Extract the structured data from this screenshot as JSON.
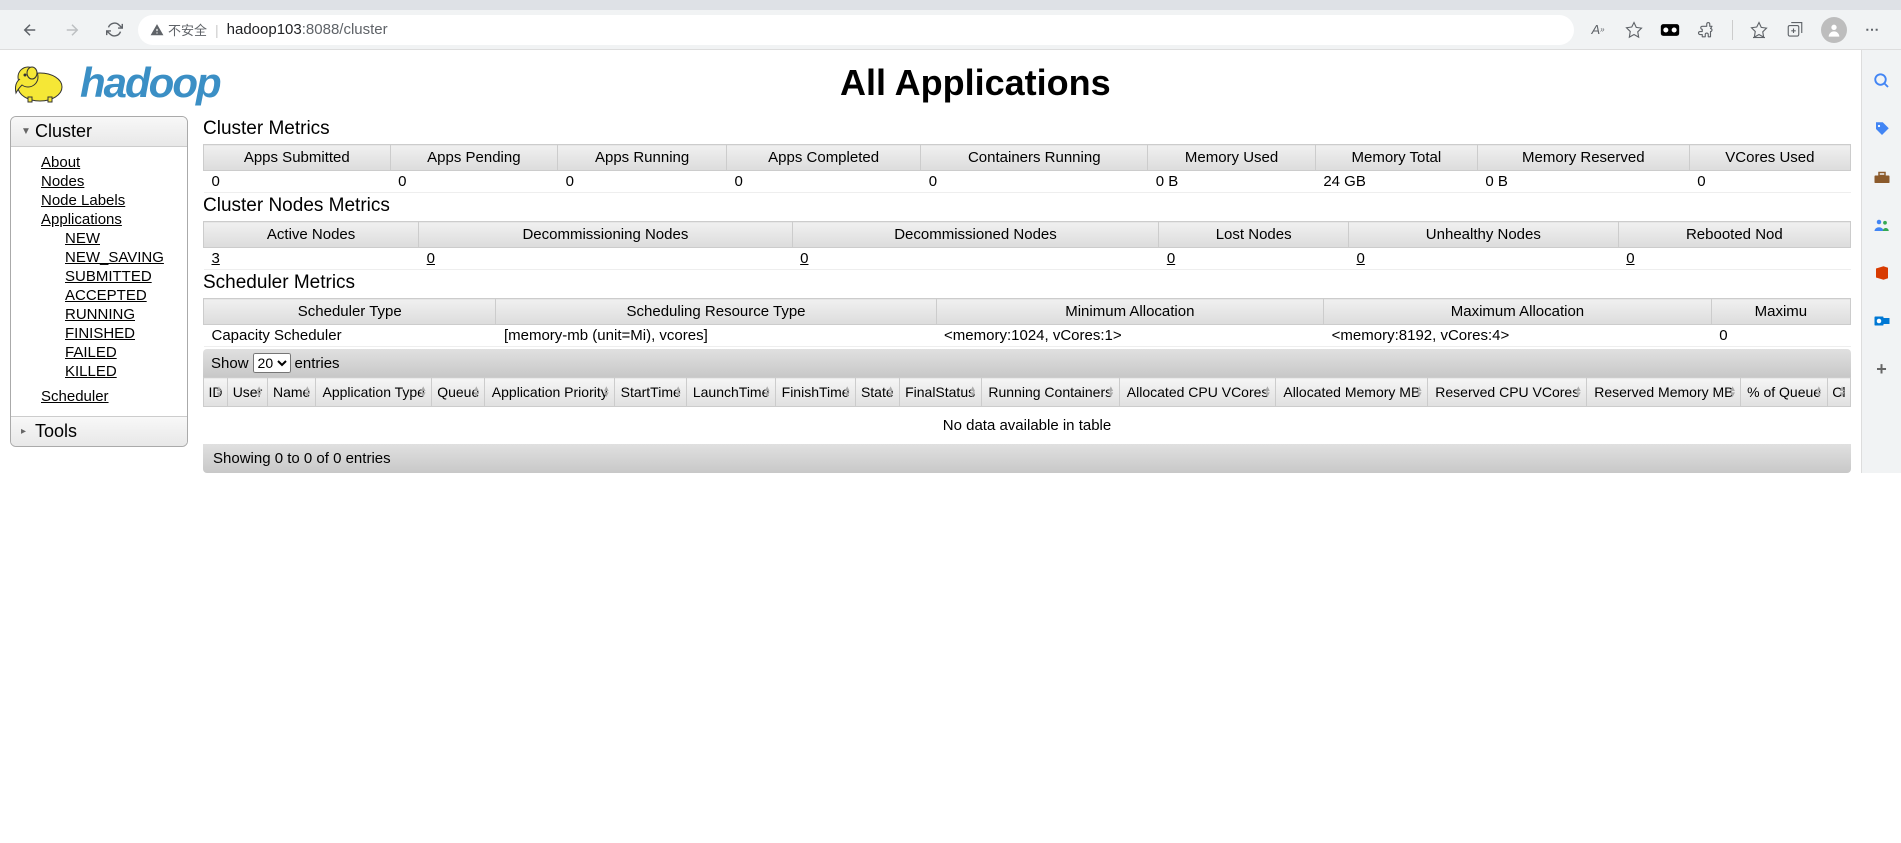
{
  "browser": {
    "url_prefix": "hadoop103",
    "url_suffix": ":8088/cluster",
    "insecure_label": "不安全"
  },
  "logo_text": "hadoop",
  "page_title": "All Applications",
  "sidebar": {
    "cluster_label": "Cluster",
    "tools_label": "Tools",
    "items": [
      {
        "label": "About"
      },
      {
        "label": "Nodes"
      },
      {
        "label": "Node Labels"
      },
      {
        "label": "Applications"
      }
    ],
    "app_states": [
      {
        "label": "NEW"
      },
      {
        "label": "NEW_SAVING"
      },
      {
        "label": "SUBMITTED"
      },
      {
        "label": "ACCEPTED"
      },
      {
        "label": "RUNNING"
      },
      {
        "label": "FINISHED"
      },
      {
        "label": "FAILED"
      },
      {
        "label": "KILLED"
      }
    ],
    "scheduler_label": "Scheduler"
  },
  "cluster_metrics": {
    "title": "Cluster Metrics",
    "headers": [
      "Apps Submitted",
      "Apps Pending",
      "Apps Running",
      "Apps Completed",
      "Containers Running",
      "Memory Used",
      "Memory Total",
      "Memory Reserved",
      "VCores Used"
    ],
    "values": [
      "0",
      "0",
      "0",
      "0",
      "0",
      "0 B",
      "24 GB",
      "0 B",
      "0"
    ]
  },
  "node_metrics": {
    "title": "Cluster Nodes Metrics",
    "headers": [
      "Active Nodes",
      "Decommissioning Nodes",
      "Decommissioned Nodes",
      "Lost Nodes",
      "Unhealthy Nodes",
      "Rebooted Nod"
    ],
    "values": [
      "3",
      "0",
      "0",
      "0",
      "0",
      "0"
    ]
  },
  "scheduler_metrics": {
    "title": "Scheduler Metrics",
    "headers": [
      "Scheduler Type",
      "Scheduling Resource Type",
      "Minimum Allocation",
      "Maximum Allocation",
      "Maximu"
    ],
    "values": [
      "Capacity Scheduler",
      "[memory-mb (unit=Mi), vcores]",
      "<memory:1024, vCores:1>",
      "<memory:8192, vCores:4>",
      "0"
    ]
  },
  "apps_table": {
    "show_label": "Show",
    "entries_label": "entries",
    "page_size": "20",
    "headers": [
      "ID",
      "User",
      "Name",
      "Application Type",
      "Queue",
      "Application Priority",
      "StartTime",
      "LaunchTime",
      "FinishTime",
      "State",
      "FinalStatus",
      "Running Containers",
      "Allocated CPU VCores",
      "Allocated Memory MB",
      "Reserved CPU VCores",
      "Reserved Memory MB",
      "% of Queue",
      "Cl"
    ],
    "empty_msg": "No data available in table",
    "footer": "Showing 0 to 0 of 0 entries"
  }
}
